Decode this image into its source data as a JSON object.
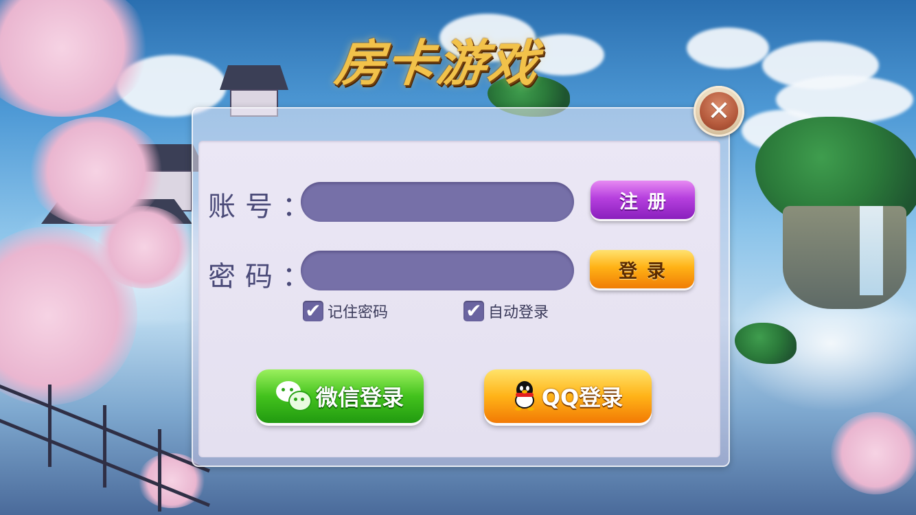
{
  "title": "房卡游戏",
  "dialog": {
    "close_label": "✕",
    "account": {
      "label": "账号：",
      "value": "",
      "placeholder": ""
    },
    "password": {
      "label": "密码：",
      "value": "",
      "placeholder": ""
    },
    "register_button": "注册",
    "login_button": "登录",
    "remember_password": {
      "label": "记住密码",
      "checked": true
    },
    "auto_login": {
      "label": "自动登录",
      "checked": true
    },
    "wechat_login": "微信登录",
    "qq_login": "QQ登录"
  },
  "colors": {
    "input_fill": "#7670a8",
    "register_purple": "#b640de",
    "login_orange": "#ffb216",
    "wechat_green": "#43c21d",
    "qq_orange": "#ffb318",
    "title_gold": "#f2c24a"
  },
  "icons": {
    "close": "close-icon",
    "check": "checkmark-icon",
    "wechat": "wechat-icon",
    "qq": "qq-penguin-icon"
  }
}
